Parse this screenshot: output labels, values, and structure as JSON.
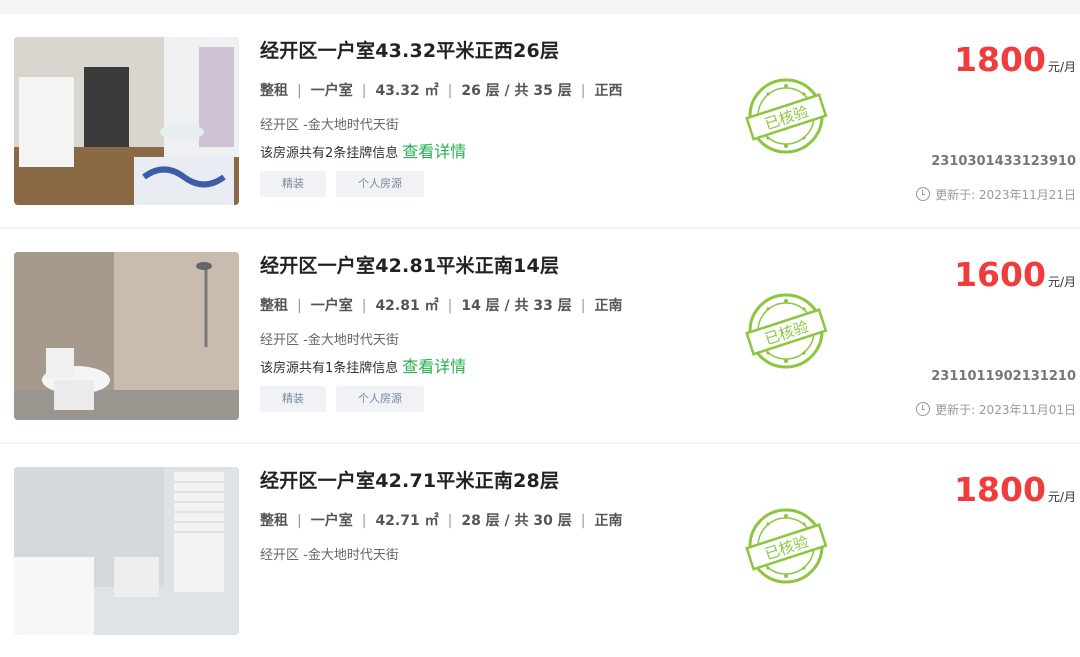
{
  "listings": [
    {
      "title": "经开区一户室43.32平米正西26层",
      "rent_type": "整租",
      "layout": "一户室",
      "area": "43.32 ㎡",
      "floor": "26 层 / 共 35 层",
      "orientation": "正西",
      "address": "经开区 -金大地时代天街",
      "count_text": "该房源共有2条挂牌信息",
      "detail_link": "查看详情",
      "tags": [
        "精装",
        "个人房源"
      ],
      "stamp_text": "已核验",
      "price": "1800",
      "price_unit": "元/月",
      "code": "2310301433123910",
      "updated": "更新于: 2023年11月21日",
      "image_icon": "room-photo-living"
    },
    {
      "title": "经开区一户室42.81平米正南14层",
      "rent_type": "整租",
      "layout": "一户室",
      "area": "42.81 ㎡",
      "floor": "14 层 / 共 33 层",
      "orientation": "正南",
      "address": "经开区 -金大地时代天街",
      "count_text": "该房源共有1条挂牌信息",
      "detail_link": "查看详情",
      "tags": [
        "精装",
        "个人房源"
      ],
      "stamp_text": "已核验",
      "price": "1600",
      "price_unit": "元/月",
      "code": "2311011902131210",
      "updated": "更新于: 2023年11月01日",
      "image_icon": "room-photo-bathroom"
    },
    {
      "title": "经开区一户室42.71平米正南28层",
      "rent_type": "整租",
      "layout": "一户室",
      "area": "42.71 ㎡",
      "floor": "28 层 / 共 30 层",
      "orientation": "正南",
      "address": "经开区 -金大地时代天街",
      "stamp_text": "已核验",
      "price": "1800",
      "price_unit": "元/月",
      "image_icon": "room-photo-bedroom"
    }
  ],
  "colors": {
    "price": "#f03c3c",
    "link": "#22b14c",
    "stamp": "#8cc63f"
  }
}
